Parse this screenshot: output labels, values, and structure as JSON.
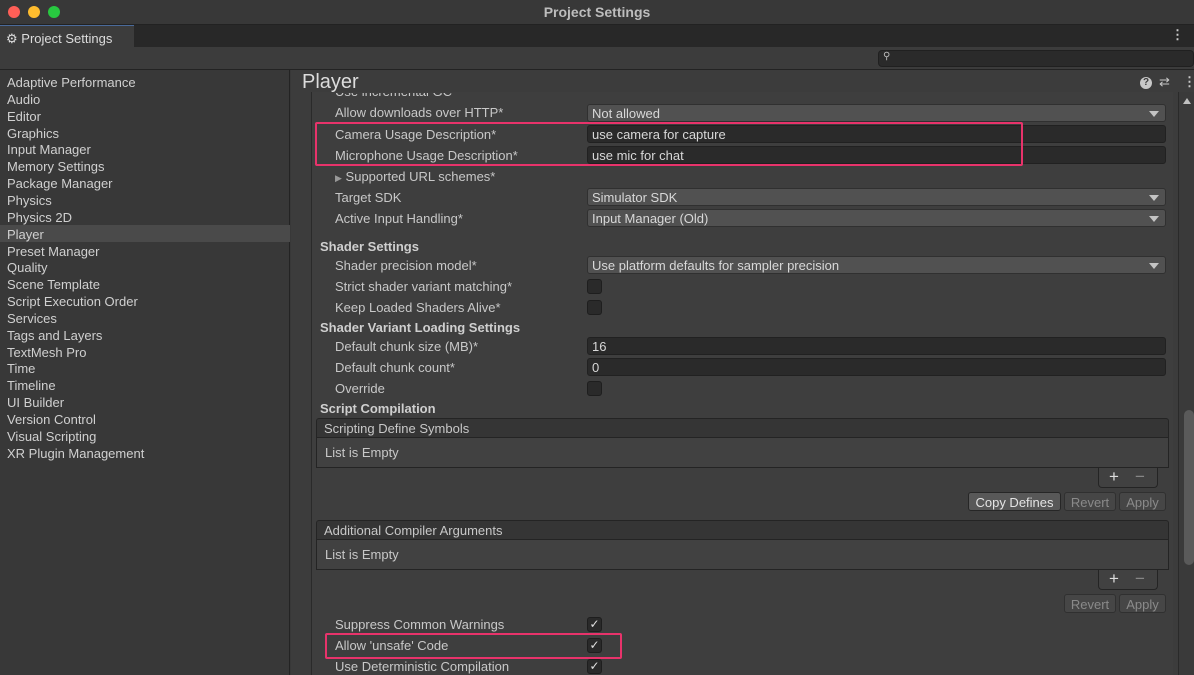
{
  "window": {
    "title": "Project Settings",
    "tab": "Project Settings",
    "colors": {
      "close": "#fe5f57",
      "minimize": "#febc2e",
      "zoom": "#28c840",
      "highlight": "#e8336b"
    }
  },
  "search": {
    "placeholder": ""
  },
  "sidebar": {
    "items": [
      "Adaptive Performance",
      "Audio",
      "Editor",
      "Graphics",
      "Input Manager",
      "Memory Settings",
      "Package Manager",
      "Physics",
      "Physics 2D",
      "Player",
      "Preset Manager",
      "Quality",
      "Scene Template",
      "Script Execution Order",
      "Services",
      "Tags and Layers",
      "TextMesh Pro",
      "Time",
      "Timeline",
      "UI Builder",
      "Version Control",
      "Visual Scripting",
      "XR Plugin Management"
    ],
    "selected": "Player"
  },
  "main": {
    "title": "Player",
    "cut_label": "Use incremental GC",
    "rows": {
      "allow_http": {
        "label": "Allow downloads over HTTP*",
        "value": "Not allowed"
      },
      "camera": {
        "label": "Camera Usage Description*",
        "value": "use camera for capture"
      },
      "mic": {
        "label": "Microphone Usage Description*",
        "value": "use mic for chat"
      },
      "url_schemes": {
        "label": "Supported URL schemes*"
      },
      "target_sdk": {
        "label": "Target SDK",
        "value": "Simulator SDK"
      },
      "input_handling": {
        "label": "Active Input Handling*",
        "value": "Input Manager (Old)"
      },
      "shader_settings": "Shader Settings",
      "precision": {
        "label": "Shader precision model*",
        "value": "Use platform defaults for sampler precision"
      },
      "strict": {
        "label": "Strict shader variant matching*",
        "checked": false
      },
      "keep_loaded": {
        "label": "Keep Loaded Shaders Alive*",
        "checked": false
      },
      "variant_loading": "Shader Variant Loading Settings",
      "chunk_size": {
        "label": "Default chunk size (MB)*",
        "value": "16"
      },
      "chunk_count": {
        "label": "Default chunk count*",
        "value": "0"
      },
      "override": {
        "label": "Override",
        "checked": false
      },
      "script_compilation": "Script Compilation",
      "define_symbols": {
        "header": "Scripting Define Symbols",
        "empty": "List is Empty",
        "add": "+",
        "remove": "−",
        "copy": "Copy Defines",
        "revert": "Revert",
        "apply": "Apply"
      },
      "compiler_args": {
        "header": "Additional Compiler Arguments",
        "empty": "List is Empty",
        "add": "+",
        "remove": "−",
        "revert": "Revert",
        "apply": "Apply"
      },
      "suppress": {
        "label": "Suppress Common Warnings",
        "checked": true,
        "mark": "✓"
      },
      "unsafe": {
        "label": "Allow 'unsafe' Code",
        "checked": true,
        "mark": "✓"
      },
      "deterministic": {
        "label": "Use Deterministic Compilation",
        "checked": true,
        "mark": "✓"
      }
    }
  }
}
